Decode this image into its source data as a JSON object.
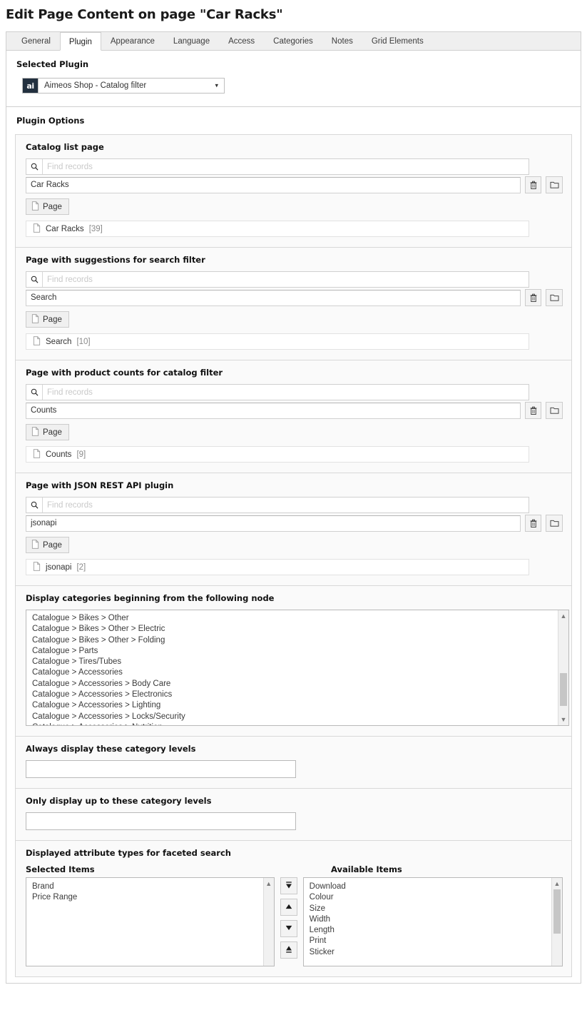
{
  "page": {
    "title": "Edit Page Content on page \"Car Racks\""
  },
  "tabs": [
    {
      "label": "General",
      "active": false
    },
    {
      "label": "Plugin",
      "active": true
    },
    {
      "label": "Appearance",
      "active": false
    },
    {
      "label": "Language",
      "active": false
    },
    {
      "label": "Access",
      "active": false
    },
    {
      "label": "Categories",
      "active": false
    },
    {
      "label": "Notes",
      "active": false
    },
    {
      "label": "Grid Elements",
      "active": false
    }
  ],
  "selected_plugin": {
    "heading": "Selected Plugin",
    "badge": "ai",
    "value": "Aimeos Shop - Catalog filter",
    "caret": "chevron-down-icon"
  },
  "plugin_options": {
    "heading": "Plugin Options",
    "sections": [
      {
        "label": "Catalog list page",
        "search_placeholder": "Find records",
        "search_value": "",
        "value": "Car Racks",
        "page_button": "Page",
        "result_name": "Car Racks",
        "result_count": "[39]"
      },
      {
        "label": "Page with suggestions for search filter",
        "search_placeholder": "Find records",
        "search_value": "",
        "value": "Search",
        "page_button": "Page",
        "result_name": "Search",
        "result_count": "[10]"
      },
      {
        "label": "Page with product counts for catalog filter",
        "search_placeholder": "Find records",
        "search_value": "",
        "value": "Counts",
        "page_button": "Page",
        "result_name": "Counts",
        "result_count": "[9]"
      },
      {
        "label": "Page with JSON REST API plugin",
        "search_placeholder": "Find records",
        "search_value": "",
        "value": "jsonapi",
        "page_button": "Page",
        "result_name": "jsonapi",
        "result_count": "[2]"
      }
    ],
    "category_node": {
      "label": "Display categories beginning from the following node",
      "options": [
        "Catalogue > Bikes > Other",
        "Catalogue > Bikes > Other > Electric",
        "Catalogue > Bikes > Other > Folding",
        "Catalogue > Parts",
        "Catalogue > Tires/Tubes",
        "Catalogue > Accessories",
        "Catalogue > Accessories > Body Care",
        "Catalogue > Accessories > Electronics",
        "Catalogue > Accessories > Lighting",
        "Catalogue > Accessories > Locks/Security",
        "Catalogue > Accessories > Nutrition"
      ]
    },
    "always_levels": {
      "label": "Always display these category levels",
      "value": ""
    },
    "max_levels": {
      "label": "Only display up to these category levels",
      "value": ""
    },
    "attribute_types": {
      "label": "Displayed attribute types for faceted search",
      "selected_label": "Selected Items",
      "available_label": "Available Items",
      "selected_items": [
        "Brand",
        "Price Range"
      ],
      "available_items": [
        "Download",
        "Colour",
        "Size",
        "Width",
        "Length",
        "Print",
        "Sticker"
      ],
      "buttons": [
        {
          "name": "move-to-top-button",
          "glyph": "top-arrow-icon"
        },
        {
          "name": "move-up-button",
          "glyph": "up-arrow-icon"
        },
        {
          "name": "move-down-button",
          "glyph": "down-arrow-icon"
        },
        {
          "name": "move-to-bottom-button",
          "glyph": "bottom-arrow-icon"
        }
      ]
    }
  },
  "colors": {
    "plugin_badge_bg": "#22303f",
    "tab_bar_bg": "#efefef",
    "panel_border": "#cfcfcf",
    "section_bg": "#fafafa",
    "scroll_thumb": "#c6c6c6"
  }
}
